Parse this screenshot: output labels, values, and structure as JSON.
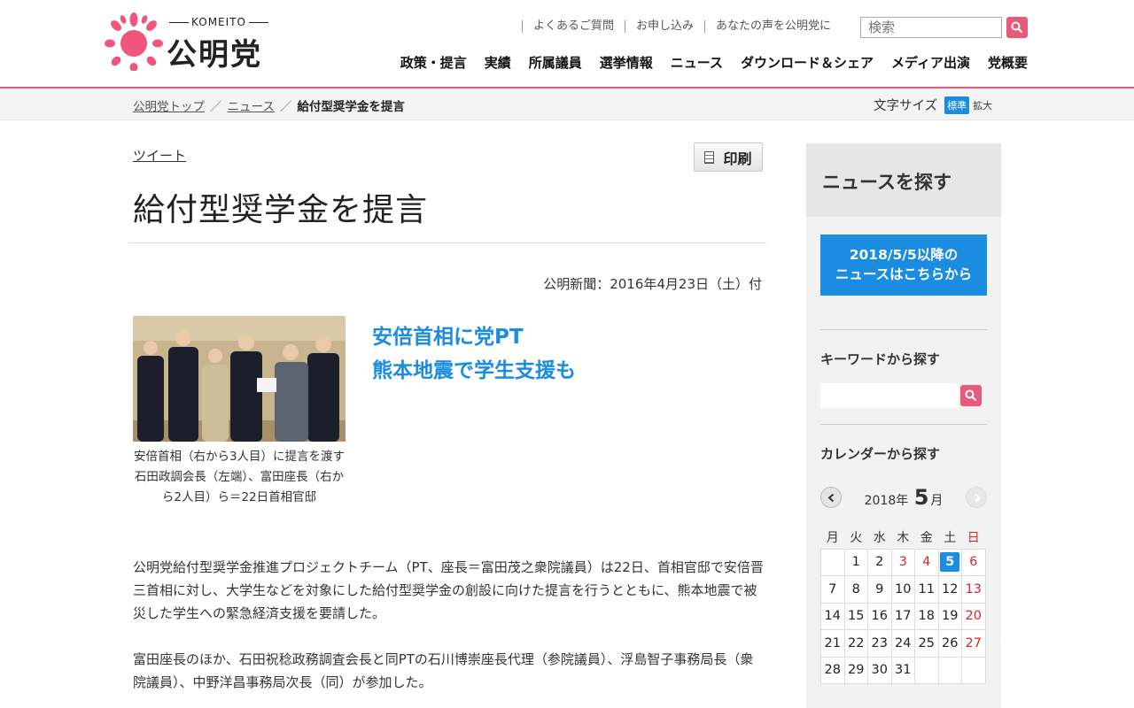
{
  "header": {
    "logo_small": "KOMEITO",
    "logo_name": "公明党",
    "util_links": [
      "よくあるご質問",
      "お申し込み",
      "あなたの声を公明党に"
    ],
    "search_placeholder": "検索",
    "nav": [
      "政策・提言",
      "実績",
      "所属議員",
      "選挙情報",
      "ニュース",
      "ダウンロード＆シェア",
      "メディア出演",
      "党概要"
    ],
    "accent_color": "#e75a7c"
  },
  "breadcrumb": {
    "items": [
      "公明党トップ",
      "ニュース"
    ],
    "current": "給付型奨学金を提言",
    "separator": "／"
  },
  "font_size": {
    "label": "文字サイズ",
    "standard": "標準",
    "large": "拡大"
  },
  "article": {
    "tweet": "ツイート",
    "print": "印刷",
    "title": "給付型奨学金を提言",
    "pubdate": "公明新聞：2016年4月23日（土）付",
    "caption": "安倍首相（右から3人目）に提言を渡す石田政調会長（左端）、富田座長（右から2人目）ら＝22日首相官邸",
    "headline_1": "安倍首相に党PT",
    "headline_2": "熊本地震で学生支援も",
    "paragraphs": [
      "公明党給付型奨学金推進プロジェクトチーム（PT、座長＝富田茂之衆院議員）は22日、首相官邸で安倍晋三首相に対し、大学生などを対象にした給付型奨学金の創設に向けた提言を行うとともに、熊本地震で被災した学生への緊急経済支援を要請した。",
      "富田座長のほか、石田祝稔政務調査会長と同PTの石川博崇座長代理（参院議員）、浮島智子事務局長（衆院議員）、中野洋昌事務局次長（同）が参加した。"
    ]
  },
  "sidebar": {
    "heading": "ニュースを探す",
    "banner_line1": "2018/5/5以降の",
    "banner_line2": "ニュースはこちらから",
    "keyword_label": "キーワードから探す",
    "calendar_label": "カレンダーから探す",
    "calendar": {
      "year": "2018",
      "year_suffix": "年",
      "month": "5",
      "month_suffix": "月",
      "weekdays": [
        "月",
        "火",
        "水",
        "木",
        "金",
        "土",
        "日"
      ],
      "weeks": [
        [
          "",
          "1",
          "2",
          "3",
          "4",
          "5",
          "6"
        ],
        [
          "7",
          "8",
          "9",
          "10",
          "11",
          "12",
          "13"
        ],
        [
          "14",
          "15",
          "16",
          "17",
          "18",
          "19",
          "20"
        ],
        [
          "21",
          "22",
          "23",
          "24",
          "25",
          "26",
          "27"
        ],
        [
          "28",
          "29",
          "30",
          "31",
          "",
          "",
          ""
        ]
      ],
      "today": "5",
      "holidays": [
        "3",
        "4"
      ]
    }
  }
}
